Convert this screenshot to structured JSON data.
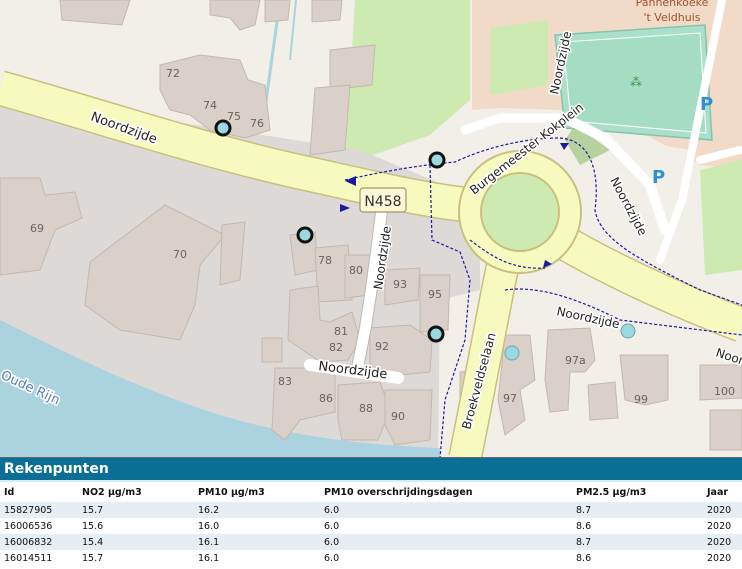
{
  "map": {
    "road_shield": "N458",
    "street_labels": {
      "noordzijde_west": "Noordzijde",
      "noordzijde_north": "Noordzijde",
      "noordzijde_ne": "Noordzijde",
      "noordzijde_center": "Noordzijde",
      "noordzijde_south": "Noordzijde",
      "noordzijde_east": "Noordzijde",
      "noordzijde_far_east": "Noordzijde",
      "burgemeester_kokplein": "Burgemeester Kokplein",
      "broekveldselaan": "Broekveldselaan",
      "oude_rijn": "Oude Rijn"
    },
    "poi_label_1": "Pannenkoeke",
    "poi_label_2": "'t Veldhuis",
    "parking_symbol": "P",
    "house_numbers": {
      "n72": "72",
      "n74": "74",
      "n75": "75",
      "n76": "76",
      "n69": "69",
      "n70": "70",
      "n78": "78",
      "n80": "80",
      "n93": "93",
      "n95": "95",
      "n81": "81",
      "n82": "82",
      "n92": "92",
      "n83": "83",
      "n86": "86",
      "n88": "88",
      "n90": "90",
      "n97": "97",
      "n97a": "97a",
      "n99": "99",
      "n100": "100"
    },
    "colors": {
      "land": "#f2efe9",
      "built_area": "#dcd9d7",
      "building": "#d9d0c9",
      "road_major": "#f7fabf",
      "road_minor": "#ffffff",
      "water": "#aad3df",
      "grass": "#cdebb0",
      "pitch": "#aae0cb",
      "commercial": "#f2dac8",
      "path": "#1a1aa0",
      "point_marker": "#9bd9e0"
    }
  },
  "panel": {
    "title": "Rekenpunten",
    "columns": [
      "Id",
      "NO2 µg/m3",
      "PM10 µg/m3",
      "PM10 overschrijdingsdagen",
      "PM2.5 µg/m3",
      "Jaar"
    ],
    "rows": [
      [
        "15827905",
        "15.7",
        "16.2",
        "6.0",
        "8.7",
        "2020"
      ],
      [
        "16006536",
        "15.6",
        "16.0",
        "6.0",
        "8.6",
        "2020"
      ],
      [
        "16006832",
        "15.4",
        "16.1",
        "6.0",
        "8.7",
        "2020"
      ],
      [
        "16014511",
        "15.7",
        "16.1",
        "6.0",
        "8.6",
        "2020"
      ]
    ]
  }
}
